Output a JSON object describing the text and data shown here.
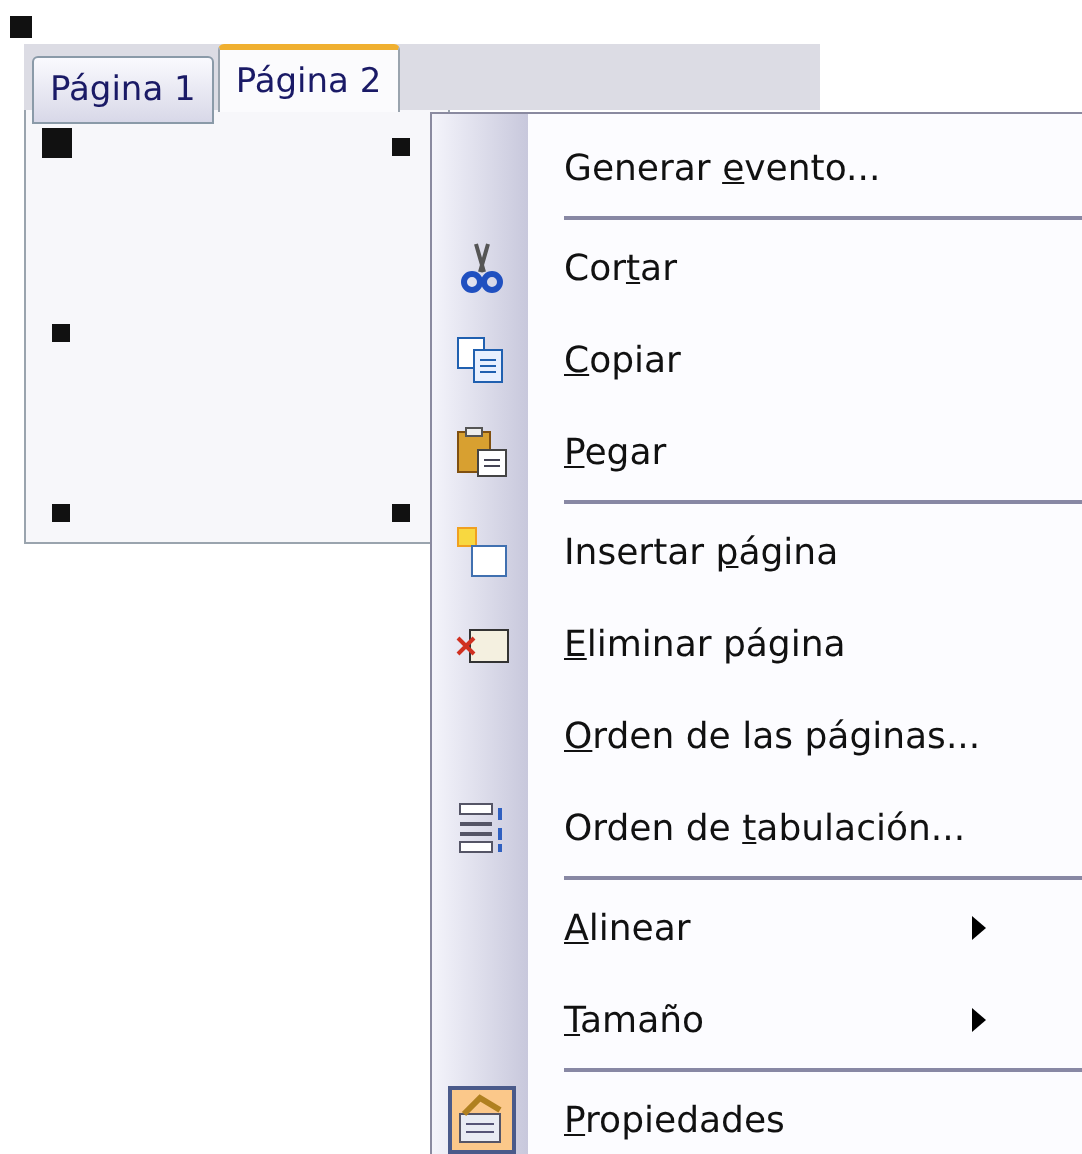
{
  "tab_control": {
    "tabs": [
      {
        "label": "Página 1",
        "selected": false
      },
      {
        "label": "Página 2",
        "selected": true
      }
    ]
  },
  "context_menu": {
    "items": [
      {
        "kind": "command",
        "label": {
          "before": "Generar ",
          "key": "e",
          "after": "vento..."
        },
        "checked": false
      },
      {
        "kind": "separator"
      },
      {
        "kind": "command",
        "label": {
          "before": "Cor",
          "key": "t",
          "after": "ar"
        },
        "checked": false
      },
      {
        "kind": "command",
        "label": {
          "key": "C",
          "after": "opiar"
        },
        "checked": false
      },
      {
        "kind": "command",
        "label": {
          "key": "P",
          "after": "egar"
        },
        "checked": false
      },
      {
        "kind": "separator"
      },
      {
        "kind": "command",
        "label": {
          "before": "Insertar ",
          "key": "p",
          "after": "ágina"
        },
        "checked": false
      },
      {
        "kind": "command",
        "label": {
          "key": "E",
          "after": "liminar página"
        },
        "checked": false
      },
      {
        "kind": "command",
        "label": {
          "key": "O",
          "after": "rden de las páginas..."
        },
        "checked": false
      },
      {
        "kind": "command",
        "label": {
          "before": "Orden de ",
          "key": "t",
          "after": "abulación..."
        },
        "checked": false
      },
      {
        "kind": "separator"
      },
      {
        "kind": "submenu",
        "label": {
          "key": "A",
          "after": "linear"
        }
      },
      {
        "kind": "submenu",
        "label": {
          "key": "T",
          "after": "amaño"
        }
      },
      {
        "kind": "separator"
      },
      {
        "kind": "command",
        "label": {
          "key": "P",
          "after": "ropiedades"
        },
        "checked": true
      }
    ]
  }
}
